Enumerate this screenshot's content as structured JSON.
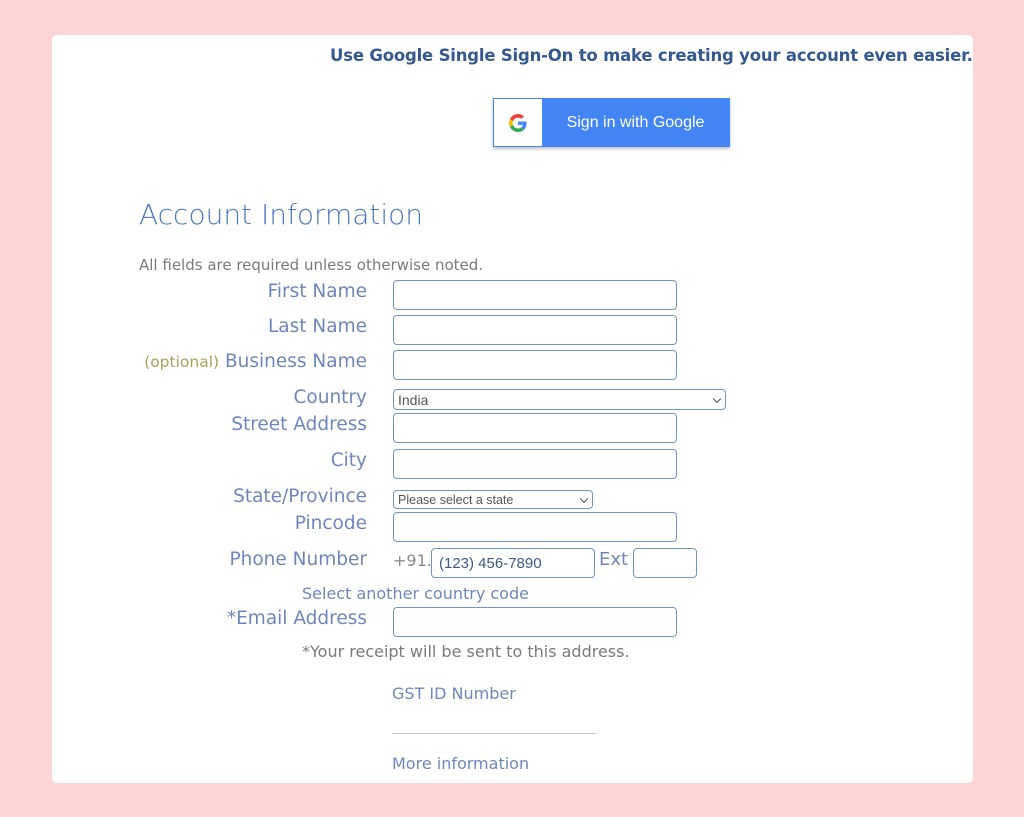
{
  "sso": {
    "prompt": "Use Google Single Sign-On to make creating your account even easier.",
    "button_label": "Sign in with Google",
    "icon": "google-g-icon"
  },
  "form": {
    "heading": "Account Information",
    "note": "All fields are required unless otherwise noted.",
    "fields": {
      "first_name": {
        "label": "First Name",
        "value": ""
      },
      "last_name": {
        "label": "Last Name",
        "value": ""
      },
      "business_name": {
        "optional_tag": "(optional)",
        "label": "Business Name",
        "value": ""
      },
      "country": {
        "label": "Country",
        "selected": "India"
      },
      "street_address": {
        "label": "Street Address",
        "value": ""
      },
      "city": {
        "label": "City",
        "value": ""
      },
      "state": {
        "label": "State/Province",
        "selected": "Please select a state"
      },
      "pincode": {
        "label": "Pincode",
        "value": ""
      },
      "phone": {
        "label": "Phone Number",
        "prefix": "+91.",
        "placeholder": "(123) 456-7890",
        "ext_label": "Ext",
        "ext_value": ""
      },
      "email": {
        "label": "*Email Address",
        "value": ""
      }
    },
    "select_country_code_link": "Select another country code",
    "receipt_note": "*Your receipt will be sent to this address.",
    "gst": {
      "label": "GST ID Number",
      "value": ""
    },
    "more_info_link": "More information"
  },
  "colors": {
    "background": "#fdd5d5",
    "google_blue": "#4285f4",
    "label_blue": "#6e86bc",
    "optional_olive": "#a9a25a"
  }
}
